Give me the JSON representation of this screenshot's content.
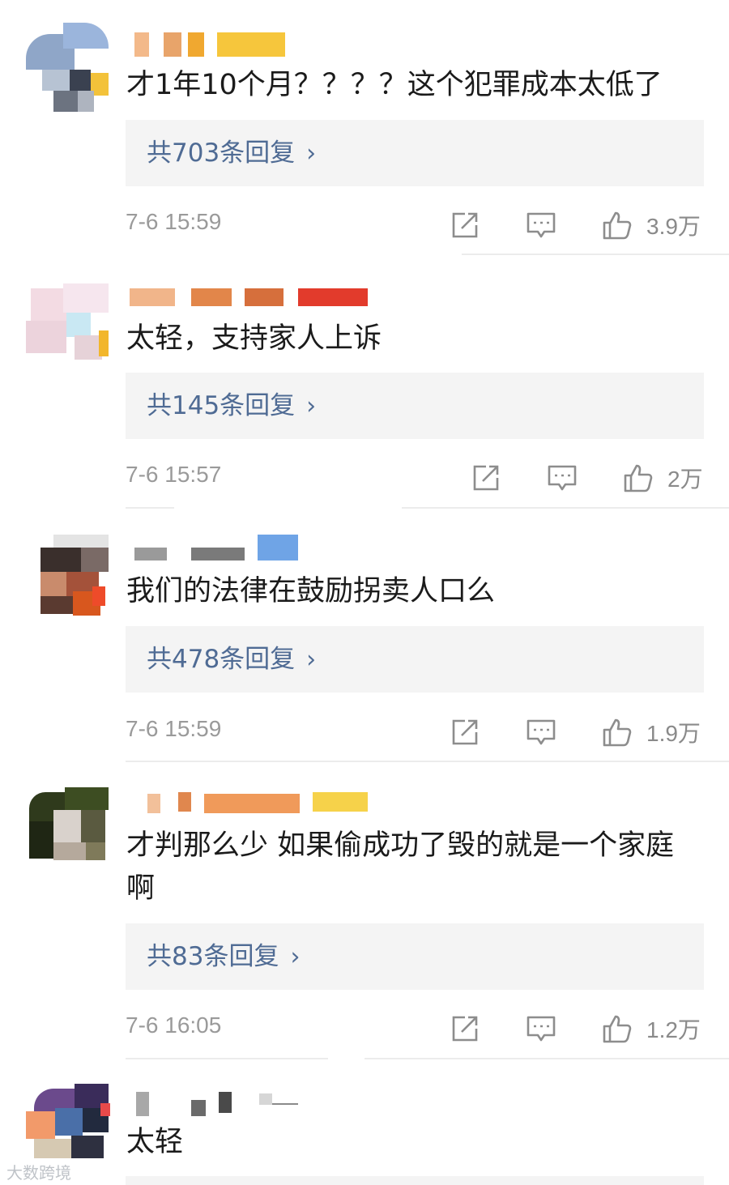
{
  "comments": [
    {
      "text": "才1年10个月？？？？这个犯罪成本太低了",
      "reply_label": "共703条回复",
      "time": "7-6 15:59",
      "likes": "3.9万"
    },
    {
      "text": "太轻，支持家人上诉",
      "reply_label": "共145条回复",
      "time": "7-6 15:57",
      "likes": "2万"
    },
    {
      "text": "我们的法律在鼓励拐卖人口么",
      "reply_label": "共478条回复",
      "time": "7-6 15:59",
      "likes": "1.9万"
    },
    {
      "text": "才判那么少 如果偷成功了毁的就是一个家庭啊",
      "reply_label": "共83条回复",
      "time": "7-6 16:05",
      "likes": "1.2万"
    },
    {
      "text": "太轻"
    }
  ],
  "icons": {
    "share": "share-icon",
    "comment": "comment-icon",
    "like": "thumbs-up-icon",
    "chevron": "chevron-right-icon"
  },
  "colors": {
    "reply_link": "#4f6b94",
    "reply_bg": "#f4f4f4",
    "meta_text": "#9a9a9a"
  },
  "watermark": "大数跨境"
}
